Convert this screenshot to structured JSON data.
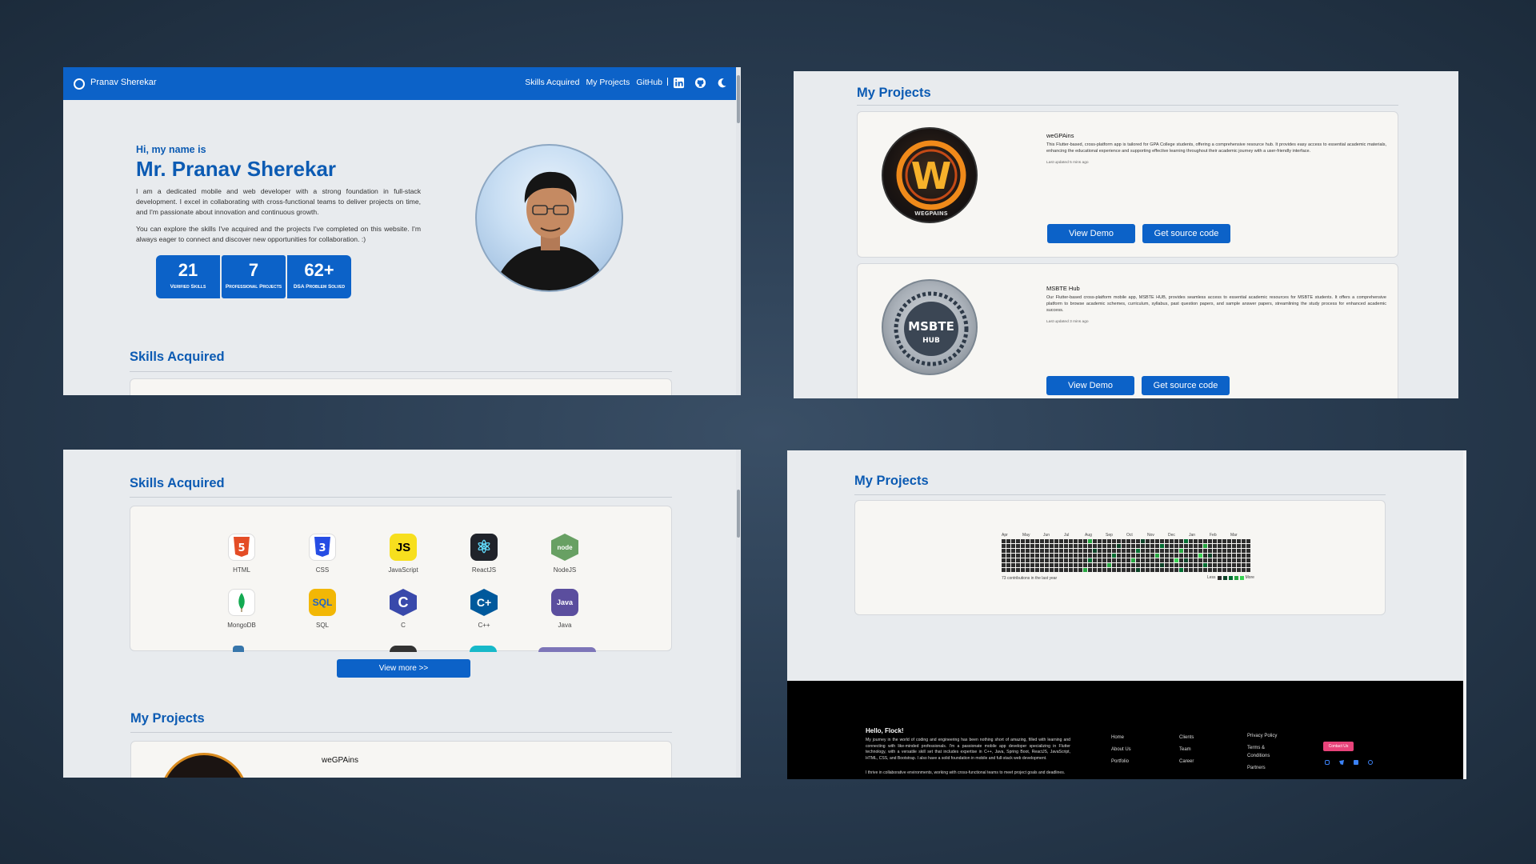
{
  "panel1": {
    "nav": {
      "brand": "Pranav Sherekar",
      "links": [
        "Skills Acquired",
        "My Projects",
        "GitHub"
      ],
      "icons": [
        "linkedin-icon",
        "github-icon",
        "moon-icon"
      ]
    },
    "hero": {
      "greeting": "Hi, my name is",
      "name": "Mr. Pranav Sherekar",
      "bio1": "I am a dedicated mobile and web developer with a strong foundation in full-stack development. I excel in collaborating with cross-functional teams to deliver projects on time, and I'm passionate about innovation and continuous growth.",
      "bio2": "You can explore the skills I've acquired and the projects I've completed on this website. I'm always eager to connect and discover new opportunities for collaboration. :)",
      "stats": [
        {
          "value": "21",
          "label": "Verified Skills"
        },
        {
          "value": "7",
          "label": "Professional Projects"
        },
        {
          "value": "62+",
          "label": "DSA Problem Solved"
        }
      ]
    },
    "skills_title": "Skills Acquired"
  },
  "panel2": {
    "title": "My Projects",
    "projects": [
      {
        "title": "weGPAins",
        "description": "This Flutter-based, cross-platform app is tailored for GPA College students, offering a comprehensive resource hub. It provides easy access to essential academic materials, enhancing the educational experience and supporting effective learning throughout their academic journey with a user-friendly interface.",
        "updated": "Last updated 5 mins ago",
        "demo_label": "View Demo",
        "source_label": "Get source code",
        "logo_text": "W",
        "logo_caption": "WEGPAINS"
      },
      {
        "title": "MSBTE Hub",
        "description": "Our Flutter-based cross-platform mobile app, MSBTE HUB, provides seamless access to essential academic resources for MSBTE students. It offers a comprehensive platform to browse academic schemes, curriculum, syllabus, past question papers, and sample answer papers, streamlining the study process for enhanced academic success.",
        "updated": "Last updated 3 mins ago",
        "demo_label": "View Demo",
        "source_label": "Get source code",
        "logo_text": "MSBTE",
        "logo_caption": "HUB"
      }
    ]
  },
  "panel3": {
    "skills_title": "Skills Acquired",
    "skills": [
      {
        "label": "HTML",
        "icon": "html5-icon",
        "glyph": "5",
        "color": "#e44d26"
      },
      {
        "label": "CSS",
        "icon": "css3-icon",
        "glyph": "3",
        "color": "#264de4"
      },
      {
        "label": "JavaScript",
        "icon": "javascript-icon",
        "glyph": "JS",
        "color": "#f7df1e"
      },
      {
        "label": "ReactJS",
        "icon": "react-icon",
        "glyph": "⚛",
        "color": "#20232a"
      },
      {
        "label": "NodeJS",
        "icon": "nodejs-icon",
        "glyph": "node",
        "color": "#68a063"
      },
      {
        "label": "MongoDB",
        "icon": "mongodb-icon",
        "glyph": "🍃",
        "color": "#ffffff"
      },
      {
        "label": "SQL",
        "icon": "sql-icon",
        "glyph": "SQL",
        "color": "#f2b705"
      },
      {
        "label": "C",
        "icon": "c-icon",
        "glyph": "C",
        "color": "#3949ab"
      },
      {
        "label": "C++",
        "icon": "cpp-icon",
        "glyph": "C+",
        "color": "#00599c"
      },
      {
        "label": "Java",
        "icon": "java-icon",
        "glyph": "Java",
        "color": "#5b4e9e"
      }
    ],
    "view_more_label": "View more >>",
    "projects_title": "My Projects",
    "partial_project_title": "weGPAins"
  },
  "panel4": {
    "projects_title": "My Projects",
    "contrib": {
      "months": [
        "Apr",
        "May",
        "Jun",
        "Jul",
        "Aug",
        "Sep",
        "Oct",
        "Nov",
        "Dec",
        "Jan",
        "Feb",
        "Mar"
      ],
      "summary": "73 contributions in the last year",
      "less_label": "Less",
      "more_label": "More"
    },
    "footer": {
      "greeting": "Hello, Flock!",
      "para1": "My journey in the world of coding and engineering has been nothing short of amazing, filled with learning and connecting with like-minded professionals. I'm a passionate mobile app developer specializing in Flutter technology, with a versatile skill set that includes expertise in C++, Java, Spring Boot, ReactJS, JavaScript, HTML, CSS, and Bootstrap. I also have a solid foundation in mobile and full-stack web development.",
      "para2": "I thrive in collaborative environments, working with cross-functional teams to meet project goals and deadlines.",
      "col1": [
        "Home",
        "About Us",
        "Portfolio"
      ],
      "col2": [
        "Clients",
        "Team",
        "Career"
      ],
      "col3": [
        "Privacy Policy",
        "Terms & Conditions",
        "Partners"
      ],
      "contact_label": "Contact Us",
      "social_icons": [
        "instagram-icon",
        "twitter-icon",
        "linkedin-icon",
        "github-icon"
      ]
    }
  },
  "colors": {
    "primary": "#0c62c8",
    "heading": "#0c5bb3",
    "contact_button": "#e8437a"
  }
}
